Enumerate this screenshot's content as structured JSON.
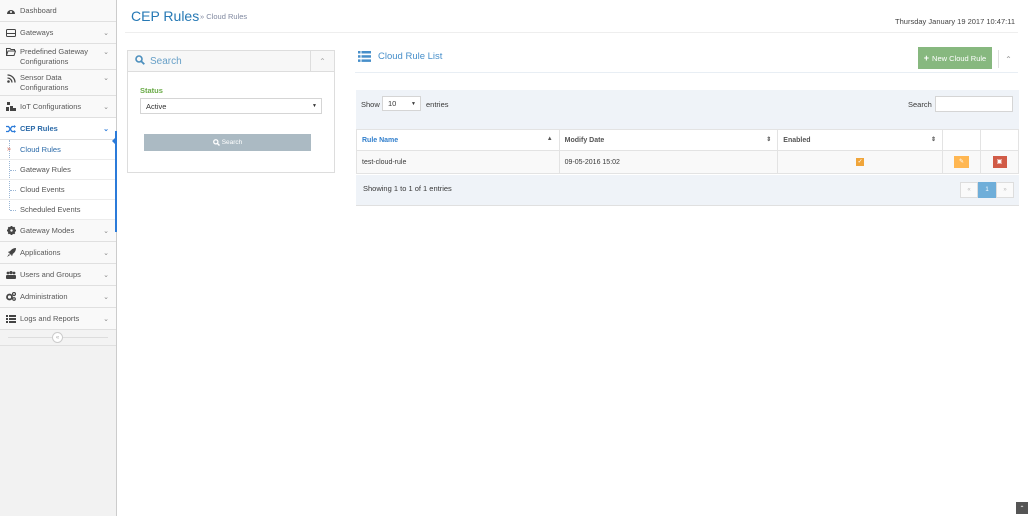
{
  "sidebar": {
    "items": [
      {
        "label": "Dashboard",
        "icon": "tachometer-icon",
        "has_children": false
      },
      {
        "label": "Gateways",
        "icon": "hdd-icon",
        "has_children": true
      },
      {
        "label": "Predefined Gateway Configurations",
        "icon": "folder-open-icon",
        "has_children": true
      },
      {
        "label": "Sensor Data Configurations",
        "icon": "rss-icon",
        "has_children": true
      },
      {
        "label": "IoT Configurations",
        "icon": "sitemap-icon",
        "has_children": true
      },
      {
        "label": "CEP Rules",
        "icon": "random-icon",
        "has_children": true,
        "active": true
      },
      {
        "label": "Gateway Modes",
        "icon": "cog-icon",
        "has_children": true
      },
      {
        "label": "Applications",
        "icon": "rocket-icon",
        "has_children": true
      },
      {
        "label": "Users and Groups",
        "icon": "users-icon",
        "has_children": true
      },
      {
        "label": "Administration",
        "icon": "cogs-icon",
        "has_children": true
      },
      {
        "label": "Logs and Reports",
        "icon": "list-icon",
        "has_children": true
      }
    ],
    "cep_submenu": [
      {
        "label": "Cloud Rules",
        "current": true
      },
      {
        "label": "Gateway Rules"
      },
      {
        "label": "Cloud Events"
      },
      {
        "label": "Scheduled Events"
      }
    ],
    "collapse_glyph": "«"
  },
  "header": {
    "title": "CEP Rules",
    "breadcrumb_sep": "»",
    "breadcrumb": "Cloud Rules",
    "datetime": "Thursday January 19 2017 10:47:11"
  },
  "search_widget": {
    "title": "Search",
    "status_label": "Status",
    "status_value": "Active",
    "button_label": "Search"
  },
  "list_widget": {
    "title": "Cloud Rule List",
    "new_button_label": "New Cloud Rule",
    "show_label": "Show",
    "page_length": "10",
    "entries_label": "entries",
    "search_label": "Search",
    "search_value": "",
    "columns": [
      "Rule Name",
      "Modify Date",
      "Enabled",
      "",
      ""
    ],
    "sorted_column": "Rule Name",
    "rows": [
      {
        "rule_name": "test-cloud-rule",
        "modify_date": "09-05-2016 15:02",
        "enabled": true
      }
    ],
    "info": "Showing 1 to 1 of 1 entries",
    "pagination": {
      "prev": "«",
      "current": "1",
      "next": "»"
    }
  },
  "colors": {
    "accent": "#2b7bd9",
    "success": "#87b87f",
    "warning": "#ffb752",
    "danger": "#d15b47"
  }
}
